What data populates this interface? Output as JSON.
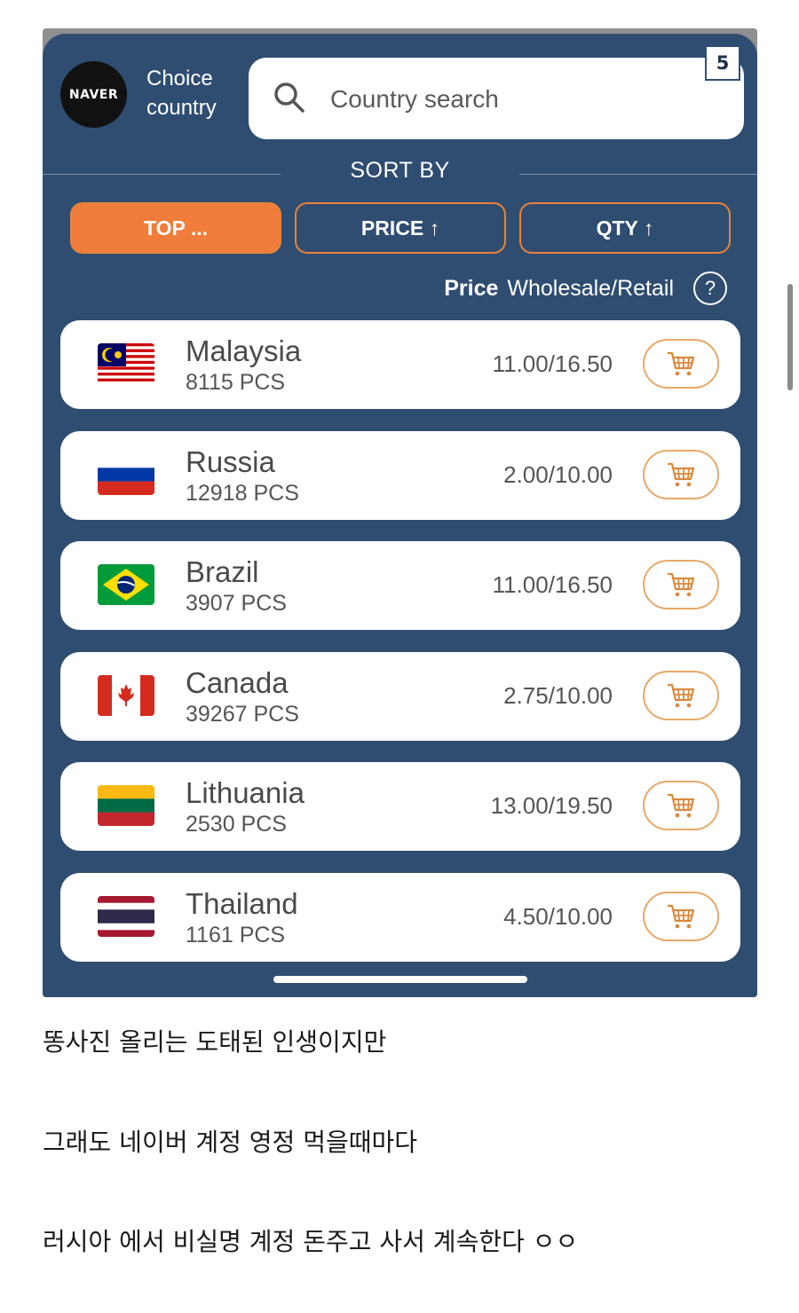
{
  "header": {
    "logo_text": "NAVER",
    "choice_label": "Choice country",
    "search_placeholder": "Country search",
    "badge": "5"
  },
  "sort": {
    "title": "SORT BY",
    "buttons": [
      {
        "label": "TOP ...",
        "active": true
      },
      {
        "label": "PRICE ↑",
        "active": false
      },
      {
        "label": "QTY ↑",
        "active": false
      }
    ]
  },
  "price_header": {
    "label": "Price",
    "type": "Wholesale/Retail",
    "help": "?"
  },
  "countries": [
    {
      "name": "Malaysia",
      "qty": "8115 PCS",
      "price": "11.00/16.50",
      "flag": "malaysia-flag"
    },
    {
      "name": "Russia",
      "qty": "12918 PCS",
      "price": "2.00/10.00",
      "flag": "russia-flag"
    },
    {
      "name": "Brazil",
      "qty": "3907 PCS",
      "price": "11.00/16.50",
      "flag": "brazil-flag"
    },
    {
      "name": "Canada",
      "qty": "39267 PCS",
      "price": "2.75/10.00",
      "flag": "canada-flag"
    },
    {
      "name": "Lithuania",
      "qty": "2530 PCS",
      "price": "13.00/19.50",
      "flag": "lithuania-flag"
    },
    {
      "name": "Thailand",
      "qty": "1161 PCS",
      "price": "4.50/10.00",
      "flag": "thailand-flag"
    }
  ],
  "colors": {
    "panel_bg": "#2f4d71",
    "accent_orange": "#f07d3c",
    "cart_border": "#e8a868"
  },
  "post_text": [
    "똥사진 올리는 도태된 인생이지만",
    "그래도 네이버 계정 영정 먹을때마다",
    "러시아 에서 비실명 계정 돈주고 사서 계속한다 ㅇㅇ"
  ]
}
